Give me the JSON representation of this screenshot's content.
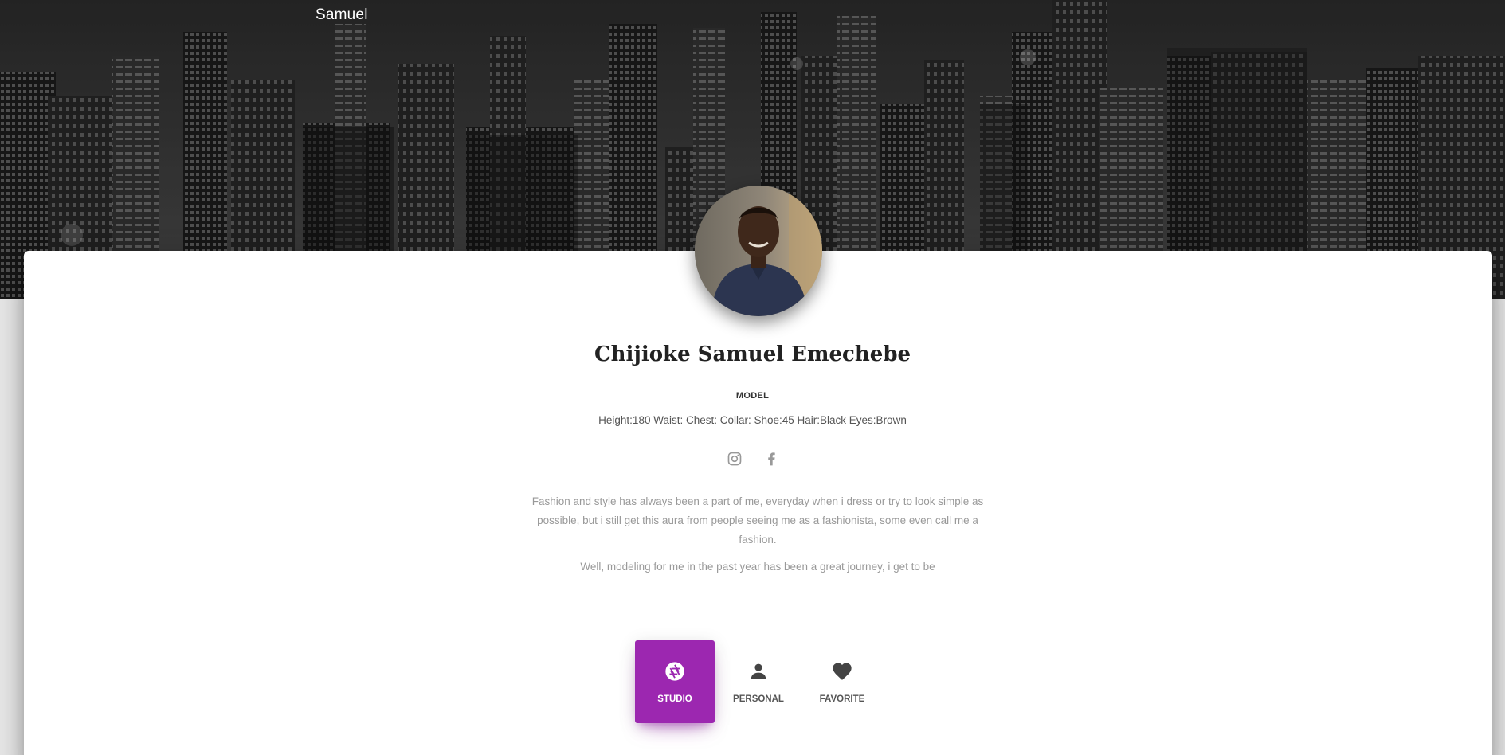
{
  "header": {
    "brand": "Samuel"
  },
  "profile": {
    "name": "Chijioke Samuel Emechebe",
    "role": "MODEL",
    "stats": "Height:180 Waist: Chest: Collar: Shoe:45 Hair:Black Eyes:Brown",
    "socials": [
      {
        "icon": "instagram-icon"
      },
      {
        "icon": "facebook-icon"
      }
    ],
    "bio": [
      "Fashion and style has always been a part of me, everyday when i dress or try to look simple as possible, but i still get this aura from people seeing me as a fashionista, some even call me a fashion.",
      "Well, modeling for me in the past year has been a great journey, i get to be"
    ]
  },
  "tabs": [
    {
      "label": "STUDIO",
      "icon": "camera-aperture-icon",
      "active": true
    },
    {
      "label": "PERSONAL",
      "icon": "person-icon",
      "active": false
    },
    {
      "label": "FAVORITE",
      "icon": "heart-icon",
      "active": false
    }
  ],
  "colors": {
    "accent": "#9c27b0",
    "card_bg": "#ffffff",
    "page_bg": "#e5e5e5"
  }
}
